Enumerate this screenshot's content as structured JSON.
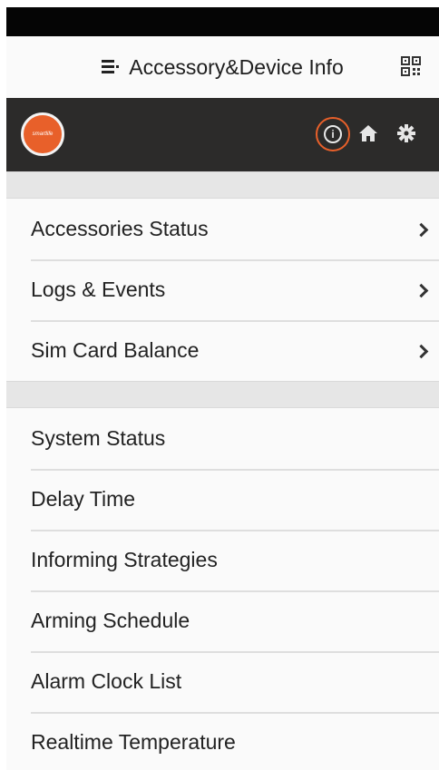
{
  "header": {
    "title": "Accessory&Device Info"
  },
  "toolbar": {
    "logo_text": "smartlife"
  },
  "group1": [
    {
      "label": "Accessories Status"
    },
    {
      "label": "Logs & Events"
    },
    {
      "label": "Sim Card Balance"
    }
  ],
  "group2": [
    {
      "label": "System Status"
    },
    {
      "label": "Delay Time"
    },
    {
      "label": "Informing Strategies"
    },
    {
      "label": "Arming Schedule"
    },
    {
      "label": "Alarm Clock List"
    },
    {
      "label": "Realtime Temperature"
    }
  ],
  "colors": {
    "accent": "#e8602a",
    "toolbar": "#2c2b2a"
  }
}
